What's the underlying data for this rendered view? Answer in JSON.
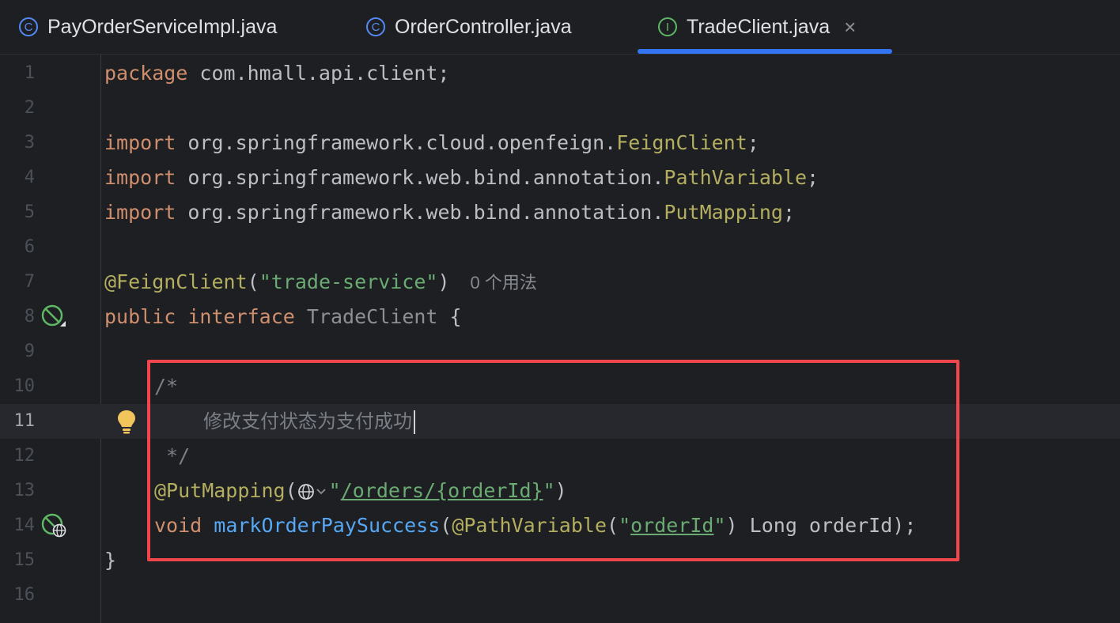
{
  "tabs": [
    {
      "label": "PayOrderServiceImpl.java",
      "icon": "class-icon",
      "icon_glyph": "C"
    },
    {
      "label": "OrderController.java",
      "icon": "class-icon",
      "icon_glyph": "C"
    },
    {
      "label": "TradeClient.java",
      "icon": "interface-icon",
      "icon_glyph": "I",
      "active": true,
      "close_glyph": "×"
    }
  ],
  "line_numbers": [
    "1",
    "2",
    "3",
    "4",
    "5",
    "6",
    "7",
    "8",
    "9",
    "10",
    "11",
    "12",
    "13",
    "14",
    "15",
    "16"
  ],
  "current_line": "11",
  "code": {
    "l1": {
      "kw": "package",
      "rest": " com.hmall.api.client;"
    },
    "l3": {
      "kw": "import",
      "pkg": " org.springframework.cloud.openfeign.",
      "cls": "FeignClient",
      "end": ";"
    },
    "l4": {
      "kw": "import",
      "pkg": " org.springframework.web.bind.annotation.",
      "cls": "PathVariable",
      "end": ";"
    },
    "l5": {
      "kw": "import",
      "pkg": " org.springframework.web.bind.annotation.",
      "cls": "PutMapping",
      "end": ";"
    },
    "l7": {
      "ann": "@FeignClient",
      "open": "(",
      "str": "\"trade-service\"",
      "close": ")",
      "hint": "0 个用法"
    },
    "l8": {
      "kw1": "public",
      "kw2": "interface",
      "name": "TradeClient",
      "brace": "{"
    },
    "l10": {
      "text": "/*"
    },
    "l11": {
      "text": "修改支付状态为支付成功"
    },
    "l12": {
      "text": " */"
    },
    "l13": {
      "ann": "@PutMapping",
      "open": "(",
      "q1": "\"",
      "path": "/orders/{orderId}",
      "q2": "\"",
      "close": ")"
    },
    "l14": {
      "kw": "void",
      "fn": "markOrderPaySuccess",
      "open": "(",
      "ann": "@PathVariable",
      "p_open": "(",
      "q1": "\"",
      "var": "orderId",
      "q2": "\"",
      "p_close": ")",
      "rest": " Long orderId);"
    },
    "l15": {
      "text": "}"
    }
  },
  "colors": {
    "keyword": "#cf8e6d",
    "annotation": "#b3ae60",
    "string": "#6aab73",
    "method": "#56a8f5",
    "comment": "#7a7e85",
    "highlight_border": "#f2464d",
    "active_tab_underline": "#3574f0"
  }
}
